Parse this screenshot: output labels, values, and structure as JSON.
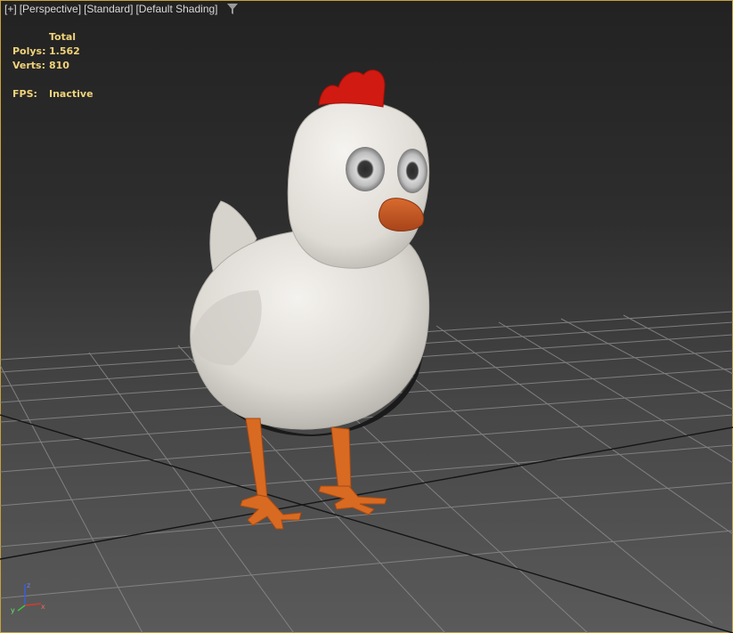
{
  "viewport": {
    "label_items": [
      "[+]",
      "[Perspective]",
      "[Standard]",
      "[Default Shading]"
    ],
    "filter_icon": "funnel-icon"
  },
  "stats": {
    "header": "Total",
    "polys_label": "Polys:",
    "polys_value": "1.562",
    "verts_label": "Verts:",
    "verts_value": "810",
    "fps_label": "FPS:",
    "fps_value": "Inactive"
  },
  "gizmo": {
    "x_label": "x",
    "y_label": "y",
    "z_label": "z"
  },
  "colors": {
    "stats_text": "#f0d27a",
    "viewport_border": "#c8a23a",
    "grid_line": "#8a8a8a",
    "chicken_body": "#e0ddd8",
    "chicken_comb": "#d01a12",
    "chicken_beak": "#c9581e",
    "chicken_legs": "#d86a22"
  }
}
